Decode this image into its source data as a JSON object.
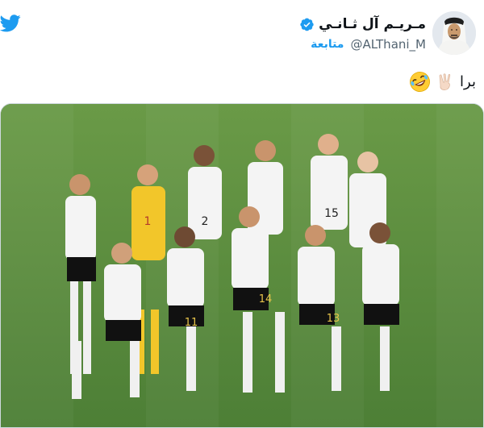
{
  "tweet": {
    "author": {
      "display_name": "مـريـم آل ثـانـي",
      "handle": "@ALThani_M",
      "follow_label": "متابعة",
      "verified": true
    },
    "text": "برا",
    "emojis": [
      "victory-hand-emoji",
      "rolling-laughing-emoji"
    ],
    "media": {
      "type": "photo",
      "jersey_numbers": [
        "1",
        "2",
        "15",
        "11",
        "14",
        "13"
      ]
    }
  },
  "colors": {
    "twitter_blue": "#1d9bf0",
    "text_primary": "#0f1419",
    "text_secondary": "#536471",
    "pitch_green": "#5b8f3f",
    "goalkeeper_yellow": "#f2c62a"
  }
}
